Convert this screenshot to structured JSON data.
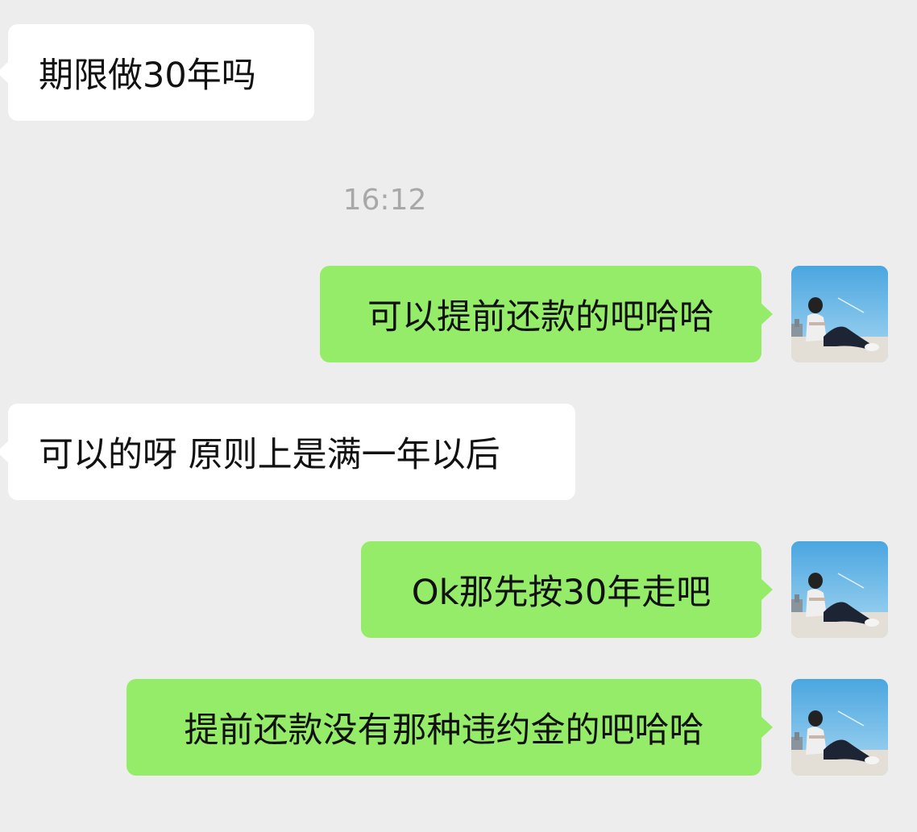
{
  "chat": {
    "timestamp": "16:12",
    "messages": [
      {
        "side": "received",
        "text": "期限做30年吗"
      },
      {
        "side": "sent",
        "text": "可以提前还款的吧哈哈"
      },
      {
        "side": "received",
        "text": "可以的呀 原则上是满一年以后"
      },
      {
        "side": "sent",
        "text": "Ok那先按30年走吧"
      },
      {
        "side": "sent",
        "text": "提前还款没有那种违约金的吧哈哈"
      }
    ]
  },
  "avatar": {
    "icon": "user-avatar-photo",
    "sky_color": "#6fb8e6",
    "sand_color": "#e3dfd6"
  },
  "colors": {
    "background": "#ededed",
    "received_bubble": "#ffffff",
    "sent_bubble": "#95ec69",
    "text": "#111111",
    "timestamp": "#a8a8a8"
  }
}
